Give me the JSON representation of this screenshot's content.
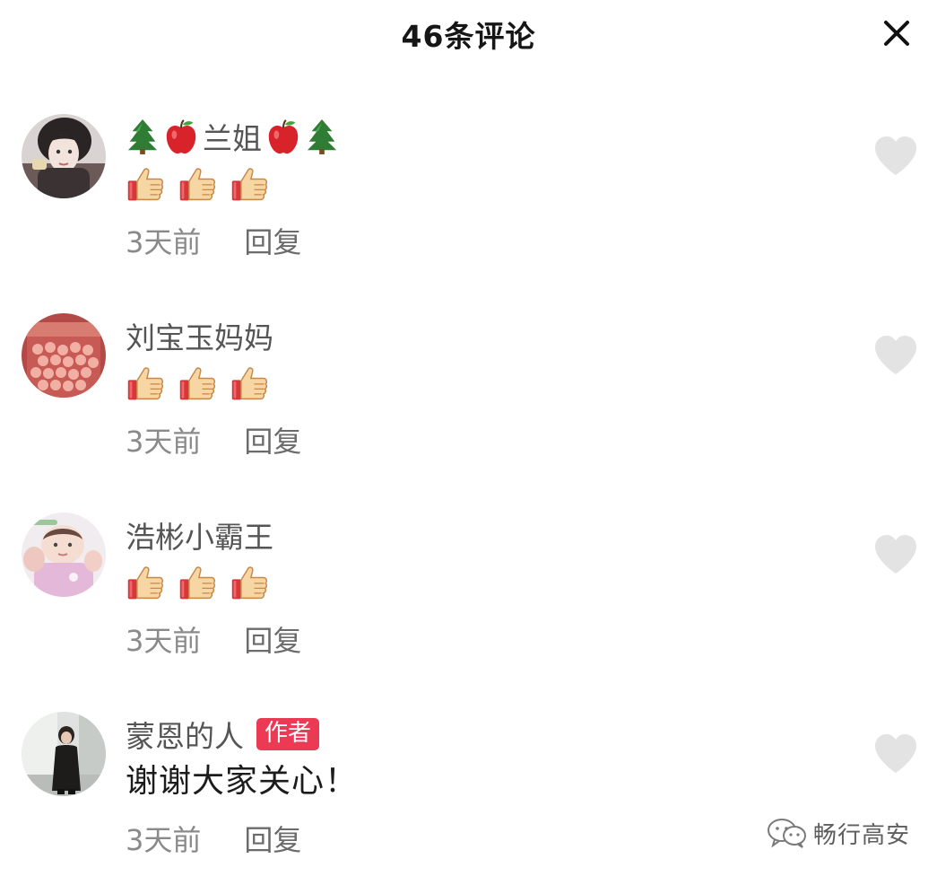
{
  "header": {
    "title": "46条评论",
    "close_icon": "close-icon"
  },
  "comments": [
    {
      "username": "兰姐",
      "name_decorations": [
        "tree-emoji",
        "apple-emoji"
      ],
      "body_emojis": [
        "thumbs-up-emoji",
        "thumbs-up-emoji",
        "thumbs-up-emoji"
      ],
      "time": "3天前",
      "reply_label": "回复",
      "like_icon": "heart-icon",
      "avatar": "woman-portrait-avatar"
    },
    {
      "username": "刘宝玉妈妈",
      "body_emojis": [
        "thumbs-up-emoji",
        "thumbs-up-emoji",
        "thumbs-up-emoji"
      ],
      "time": "3天前",
      "reply_label": "回复",
      "like_icon": "heart-icon",
      "avatar": "jar-of-fruit-avatar"
    },
    {
      "username": "浩彬小霸王",
      "body_emojis": [
        "thumbs-up-emoji",
        "thumbs-up-emoji",
        "thumbs-up-emoji"
      ],
      "time": "3天前",
      "reply_label": "回复",
      "like_icon": "heart-icon",
      "avatar": "baby-photo-avatar"
    },
    {
      "username": "蒙恩的人",
      "badge": "作者",
      "body": "谢谢大家关心！",
      "time": "3天前",
      "reply_label": "回复",
      "like_icon": "heart-icon",
      "avatar": "standing-person-avatar"
    }
  ],
  "watermark": {
    "text": "畅行高安",
    "icon": "wechat-icon"
  },
  "colors": {
    "badge": "#ec3a55",
    "heart": "#e3e3e3",
    "username": "#555555",
    "meta": "#8a8a8a"
  }
}
